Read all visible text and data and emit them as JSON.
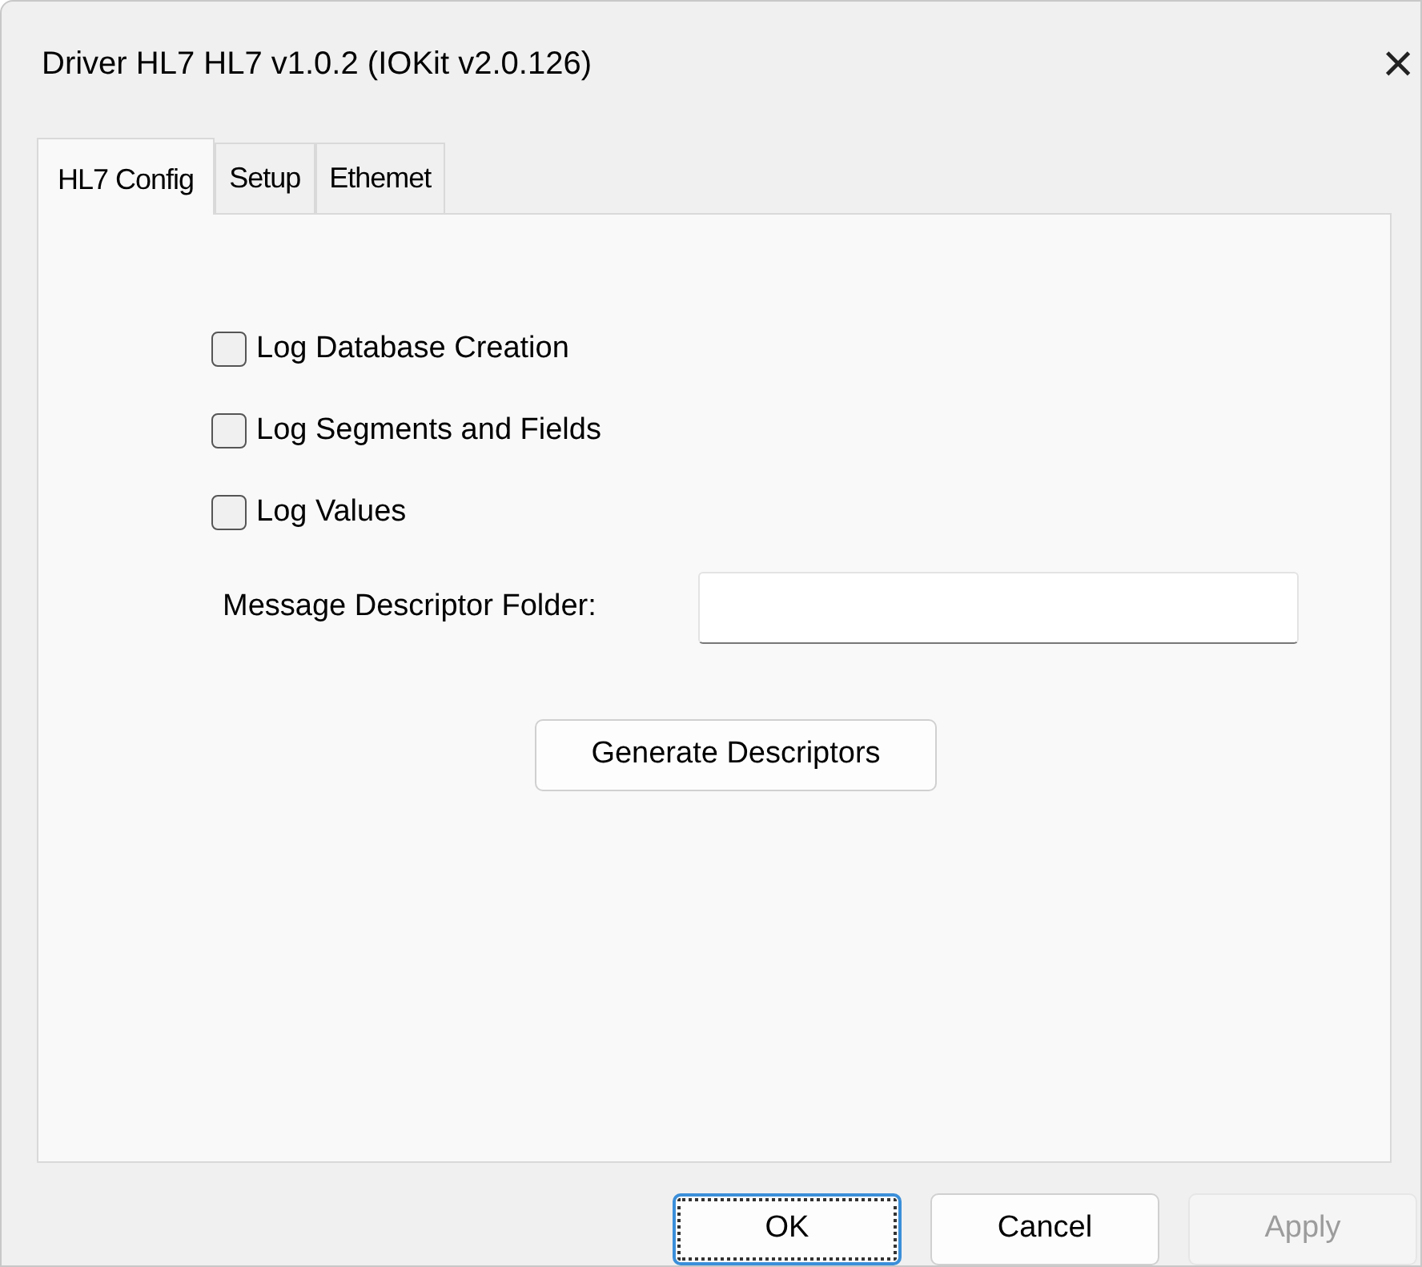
{
  "window": {
    "title": "Driver HL7 HL7 v1.0.2 (IOKit v2.0.126)",
    "close": "×"
  },
  "tabs": [
    {
      "label": "HL7 Config",
      "selected": true
    },
    {
      "label": "Setup",
      "selected": false
    },
    {
      "label": "Ethemet",
      "selected": false
    }
  ],
  "options": [
    {
      "label": "Log Database Creation",
      "checked": false
    },
    {
      "label": "Log Segments and Fields",
      "checked": false
    },
    {
      "label": "Log Values",
      "checked": false
    }
  ],
  "folder": {
    "label": "Message Descriptor Folder:"
  },
  "generate_button": "Generate Descriptors",
  "buttons": [
    {
      "label": "OK",
      "focused": true,
      "disabled": false
    },
    {
      "label": "Cancel",
      "focused": false,
      "disabled": false
    },
    {
      "label": "Apply",
      "focused": false,
      "disabled": true
    }
  ]
}
